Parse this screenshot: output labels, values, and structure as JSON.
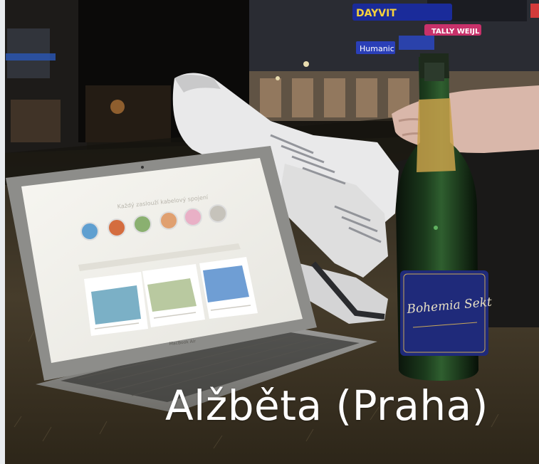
{
  "caption": "Alžběta (Praha)",
  "signs": {
    "top_sign": "DAYVIT",
    "middle_sign": "TALLY WEIJL",
    "lower_sign": "Humanic"
  },
  "bottle_label": "Bohemia Sekt",
  "laptop_brand": "MacBook Air",
  "colors": {
    "caption": "#ffffff",
    "bottle_label": "#1f2a7a",
    "laptop_screen": "#f2f1ec",
    "sneaker": "#e9e9ea",
    "night_sky": "#0f0d0b"
  }
}
